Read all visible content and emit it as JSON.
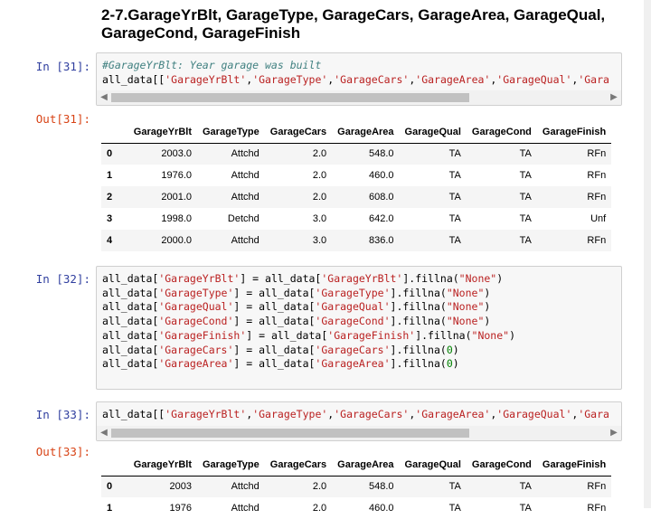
{
  "heading": "2-7.GarageYrBlt, GarageType, GarageCars, GarageArea, GarageQual, GarageCond, GarageFinish",
  "cells": {
    "in31": {
      "prompt": "In [31]:",
      "comment": "#GarageYrBlt: Year garage was built",
      "code_pre": "all_data[[",
      "cols": [
        "'GarageYrBlt'",
        "'GarageType'",
        "'GarageCars'",
        "'GarageArea'",
        "'GarageQual'",
        "'Gara"
      ]
    },
    "out31": {
      "prompt": "Out[31]:"
    },
    "in32": {
      "prompt": "In [32]:",
      "lines": [
        {
          "col": "'GarageYrBlt'",
          "fill": "\"None\""
        },
        {
          "col": "'GarageType'",
          "fill": "\"None\""
        },
        {
          "col": "'GarageQual'",
          "fill": "\"None\""
        },
        {
          "col": "'GarageCond'",
          "fill": "\"None\""
        },
        {
          "col": "'GarageFinish'",
          "fill": "\"None\""
        },
        {
          "col": "'GarageCars'",
          "fill": "0"
        },
        {
          "col": "'GarageArea'",
          "fill": "0"
        }
      ]
    },
    "in33": {
      "prompt": "In [33]:",
      "code_pre": "all_data[[",
      "cols": [
        "'GarageYrBlt'",
        "'GarageType'",
        "'GarageCars'",
        "'GarageArea'",
        "'GarageQual'",
        "'Gara"
      ]
    },
    "out33": {
      "prompt": "Out[33]:"
    }
  },
  "columns": [
    "GarageYrBlt",
    "GarageType",
    "GarageCars",
    "GarageArea",
    "GarageQual",
    "GarageCond",
    "GarageFinish"
  ],
  "table31": [
    [
      "0",
      "2003.0",
      "Attchd",
      "2.0",
      "548.0",
      "TA",
      "TA",
      "RFn"
    ],
    [
      "1",
      "1976.0",
      "Attchd",
      "2.0",
      "460.0",
      "TA",
      "TA",
      "RFn"
    ],
    [
      "2",
      "2001.0",
      "Attchd",
      "2.0",
      "608.0",
      "TA",
      "TA",
      "RFn"
    ],
    [
      "3",
      "1998.0",
      "Detchd",
      "3.0",
      "642.0",
      "TA",
      "TA",
      "Unf"
    ],
    [
      "4",
      "2000.0",
      "Attchd",
      "3.0",
      "836.0",
      "TA",
      "TA",
      "RFn"
    ]
  ],
  "table33": [
    [
      "0",
      "2003",
      "Attchd",
      "2.0",
      "548.0",
      "TA",
      "TA",
      "RFn"
    ],
    [
      "1",
      "1976",
      "Attchd",
      "2.0",
      "460.0",
      "TA",
      "TA",
      "RFn"
    ]
  ],
  "scroll_thumb_fraction": 0.72
}
